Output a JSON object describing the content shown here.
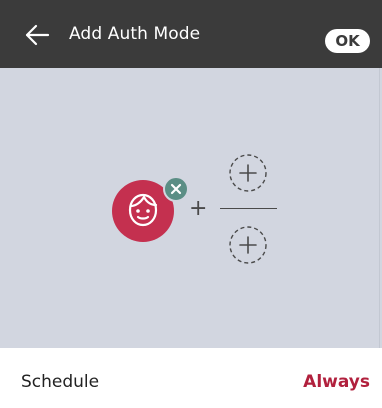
{
  "header": {
    "title": "Add Auth Mode",
    "ok_label": "OK",
    "back_icon": "arrow-left-icon"
  },
  "auth_combination": {
    "selected_mode": "face",
    "selected_icon": "face-icon",
    "remove_icon": "close-icon",
    "operator": "+",
    "slot_top_icon": "add-slot-icon",
    "slot_bottom_icon": "add-slot-icon"
  },
  "schedule": {
    "label": "Schedule",
    "value": "Always"
  },
  "colors": {
    "header_bg": "#3b3b3b",
    "canvas_bg": "#d2d6e0",
    "accent": "#c4304f",
    "remove_badge": "#5b8e85",
    "value_text": "#b1203d"
  }
}
